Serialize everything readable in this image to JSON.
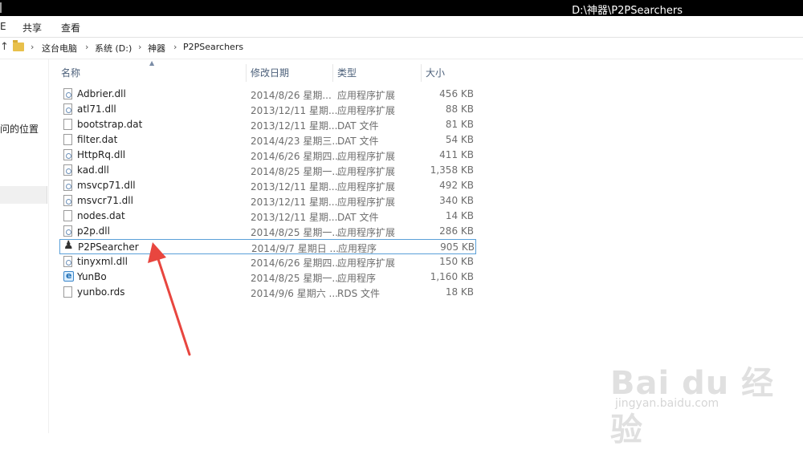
{
  "window": {
    "title": "D:\\神器\\P2PSearchers",
    "left_mark": "e"
  },
  "ribbon": {
    "left_mark": "E",
    "tabs": [
      "共享",
      "查看"
    ]
  },
  "address": {
    "up_arrow": "↑",
    "crumbs": [
      "这台电脑",
      "系统 (D:)",
      "神器",
      "P2PSearchers"
    ]
  },
  "sidebar": {
    "recent_label": "问的位置"
  },
  "columns": {
    "name": "名称",
    "date": "修改日期",
    "type": "类型",
    "size": "大小"
  },
  "files": [
    {
      "name": "Adbrier.dll",
      "date": "2014/8/26 星期...",
      "type": "应用程序扩展",
      "size": "456 KB",
      "icon": "dll-file-icon"
    },
    {
      "name": "atl71.dll",
      "date": "2013/12/11 星期...",
      "type": "应用程序扩展",
      "size": "88 KB",
      "icon": "dll-file-icon"
    },
    {
      "name": "bootstrap.dat",
      "date": "2013/12/11 星期...",
      "type": "DAT 文件",
      "size": "81 KB",
      "icon": "file-icon"
    },
    {
      "name": "filter.dat",
      "date": "2014/4/23 星期三...",
      "type": "DAT 文件",
      "size": "54 KB",
      "icon": "file-icon"
    },
    {
      "name": "HttpRq.dll",
      "date": "2014/6/26 星期四...",
      "type": "应用程序扩展",
      "size": "411 KB",
      "icon": "dll-file-icon"
    },
    {
      "name": "kad.dll",
      "date": "2014/8/25 星期一...",
      "type": "应用程序扩展",
      "size": "1,358 KB",
      "icon": "dll-file-icon"
    },
    {
      "name": "msvcp71.dll",
      "date": "2013/12/11 星期...",
      "type": "应用程序扩展",
      "size": "492 KB",
      "icon": "dll-file-icon"
    },
    {
      "name": "msvcr71.dll",
      "date": "2013/12/11 星期...",
      "type": "应用程序扩展",
      "size": "340 KB",
      "icon": "dll-file-icon"
    },
    {
      "name": "nodes.dat",
      "date": "2013/12/11 星期...",
      "type": "DAT 文件",
      "size": "14 KB",
      "icon": "file-icon"
    },
    {
      "name": "p2p.dll",
      "date": "2014/8/25 星期一...",
      "type": "应用程序扩展",
      "size": "286 KB",
      "icon": "dll-file-icon"
    },
    {
      "name": "P2PSearcher",
      "date": "2014/9/7 星期日 ...",
      "type": "应用程序",
      "size": "905 KB",
      "icon": "binoculars-app-icon",
      "selected": true
    },
    {
      "name": "tinyxml.dll",
      "date": "2014/6/26 星期四...",
      "type": "应用程序扩展",
      "size": "150 KB",
      "icon": "dll-file-icon"
    },
    {
      "name": "YunBo",
      "date": "2014/8/25 星期一...",
      "type": "应用程序",
      "size": "1,160 KB",
      "icon": "yunbo-app-icon"
    },
    {
      "name": "yunbo.rds",
      "date": "2014/9/6 星期六 ...",
      "type": "RDS 文件",
      "size": "18 KB",
      "icon": "file-icon"
    }
  ],
  "watermark": {
    "main": "Bai du 经验",
    "sub": "jingyan.baidu.com"
  },
  "colors": {
    "arrow": "#e8463f",
    "selection_border": "#5aa0d8",
    "header_text": "#4c607a"
  }
}
